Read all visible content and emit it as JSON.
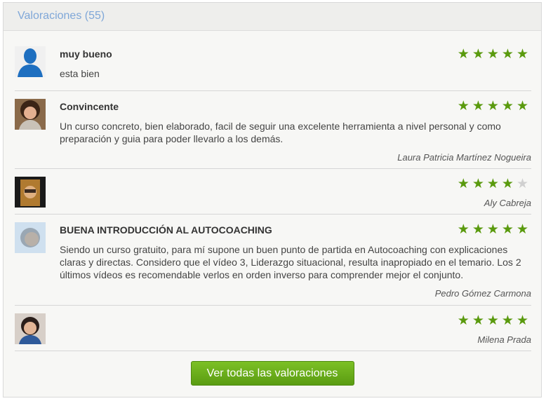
{
  "header": {
    "title": "Valoraciones (55)"
  },
  "reviews": [
    {
      "title": "muy bueno",
      "text": "esta bien",
      "author": "",
      "rating": 5,
      "stars": [
        "★",
        "★",
        "★",
        "★",
        "★"
      ]
    },
    {
      "title": "Convincente",
      "text": "Un curso concreto, bien elaborado, facil de seguir una excelente herramienta a nivel personal y como preparación y guia para poder llevarlo a los demás.",
      "author": "Laura Patricia Martínez Nogueira",
      "rating": 5,
      "stars": [
        "★",
        "★",
        "★",
        "★",
        "★"
      ]
    },
    {
      "title": "",
      "text": "",
      "author": "Aly Cabreja",
      "rating": 4,
      "stars": [
        "★",
        "★",
        "★",
        "★",
        "★"
      ]
    },
    {
      "title": "BUENA INTRODUCCIÓN AL AUTOCOACHING",
      "text": "Siendo un curso gratuito, para mí supone un buen punto de partida en Autocoaching con explicaciones claras y directas. Considero que el vídeo 3, Liderazgo situacional, resulta inapropiado en el temario. Los 2 últimos vídeos es recomendable verlos en orden inverso para comprender mejor el conjunto.",
      "author": "Pedro Gómez Carmona",
      "rating": 5,
      "stars": [
        "★",
        "★",
        "★",
        "★",
        "★"
      ]
    },
    {
      "title": "",
      "text": "",
      "author": "Milena Prada",
      "rating": 5,
      "stars": [
        "★",
        "★",
        "★",
        "★",
        "★"
      ]
    }
  ],
  "button": {
    "label": "Ver todas las valoraciones"
  },
  "colors": {
    "star_on": "#5a9a0e",
    "star_off": "#d0d0d0",
    "button": "#6aae1a",
    "header_text": "#7fa7d8"
  }
}
